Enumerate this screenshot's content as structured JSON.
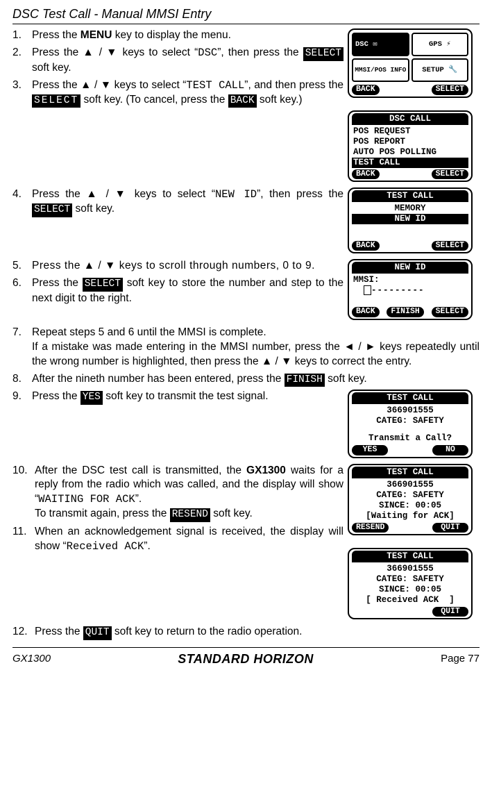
{
  "page_title": "DSC Test Call - Manual MMSI Entry",
  "steps": {
    "s1": {
      "num": "1.",
      "a": "Press the ",
      "menu": "MENU",
      "b": " key to display the menu."
    },
    "s2": {
      "num": "2.",
      "a": "Press the ▲ / ▼ keys to select “",
      "dsc": "DSC",
      "b": "”, then press the ",
      "sk": "SELECT",
      "c": " soft key."
    },
    "s3": {
      "num": "3.",
      "a": "Press the ▲ / ▼ keys to select “",
      "tc": "TEST CALL",
      "b": "”, and then press the ",
      "sk": "SELECT",
      "c": " soft key. (To cancel, press the ",
      "sk2": "BACK",
      "d": " soft key.)"
    },
    "s4": {
      "num": "4.",
      "a": "Press the ▲ / ▼ keys to select “",
      "nid": "NEW ID",
      "b": "”, then press the ",
      "sk": "SELECT",
      "c": " soft key."
    },
    "s5": {
      "num": "5.",
      "a": "Press the ▲ / ▼ keys to scroll through numbers, 0 to 9."
    },
    "s6": {
      "num": "6.",
      "a": "Press the ",
      "sk": "SELECT",
      "b": " soft key to store the number and step to the next digit to the right."
    },
    "s7": {
      "num": "7.",
      "a": "Repeat steps 5 and 6 until the MMSI is complete.",
      "b": "If a mistake was made entering in the MMSI number, press the ◄ / ► keys repeatedly until the wrong number is highlighted, then press the ▲ / ▼ keys to correct the entry."
    },
    "s8": {
      "num": "8.",
      "a": "After the nineth number has been entered, press the ",
      "sk": "FINISH",
      "b": " soft key."
    },
    "s9": {
      "num": "9.",
      "a": "Press the ",
      "sk": "YES",
      "b": " soft key to transmit the test signal."
    },
    "s10": {
      "num": "10.",
      "a": "After the DSC test call is transmitted, the ",
      "gx": "GX1300",
      "b": " waits for a reply from the radio which was called, and the display will show “",
      "w": "WAITING FOR ACK",
      "c": "”.",
      "d": "To transmit again, press the ",
      "sk": "RESEND",
      "e": " soft key."
    },
    "s11": {
      "num": "11.",
      "a": "When an acknowledgement signal is received, the display will show “",
      "r": "Received ACK",
      "b": "”."
    },
    "s12": {
      "num": "12.",
      "a": "Press the ",
      "sk": "QUIT",
      "b": " soft key to return to the radio operation."
    }
  },
  "screens": {
    "menu": {
      "tile1": "DSC ✉",
      "tile2": "GPS  ⚡",
      "tile3": "MMSI/POS INFO",
      "tile4": "SETUP 🔧",
      "sk_back": "BACK",
      "sk_select": "SELECT"
    },
    "dsc_call": {
      "title": "DSC CALL",
      "l1": "POS REQUEST",
      "l2": "POS REPORT",
      "l3": "AUTO POS POLLING",
      "l4": "TEST CALL",
      "sk_back": "BACK",
      "sk_select": "SELECT"
    },
    "test_call": {
      "title": "TEST CALL",
      "l1": "MEMORY",
      "l2": "NEW ID",
      "sk_back": "BACK",
      "sk_select": "SELECT"
    },
    "new_id": {
      "title": "NEW ID",
      "mmsi": "MMSI:",
      "dashes": "---------",
      "sk_back": "BACK",
      "sk_finish": "FINISH",
      "sk_select": "SELECT"
    },
    "transmit": {
      "title": "TEST CALL",
      "id": "366901555",
      "categ": "CATEG: SAFETY",
      "ask": "Transmit a Call?",
      "sk_yes": "YES",
      "sk_no": "NO"
    },
    "waiting": {
      "title": "TEST CALL",
      "id": "366901555",
      "categ": "CATEG: SAFETY",
      "since": "SINCE: 00:05",
      "stat": "[Waiting for ACK]",
      "sk_resend": "RESEND",
      "sk_quit": "QUIT"
    },
    "received": {
      "title": "TEST CALL",
      "id": "366901555",
      "categ": "CATEG: SAFETY",
      "since": "SINCE: 00:05",
      "stat": "[ Received ACK  ]",
      "sk_quit": "QUIT"
    }
  },
  "footer": {
    "model": "GX1300",
    "brand": "STANDARD HORIZON",
    "page": "Page 77"
  }
}
